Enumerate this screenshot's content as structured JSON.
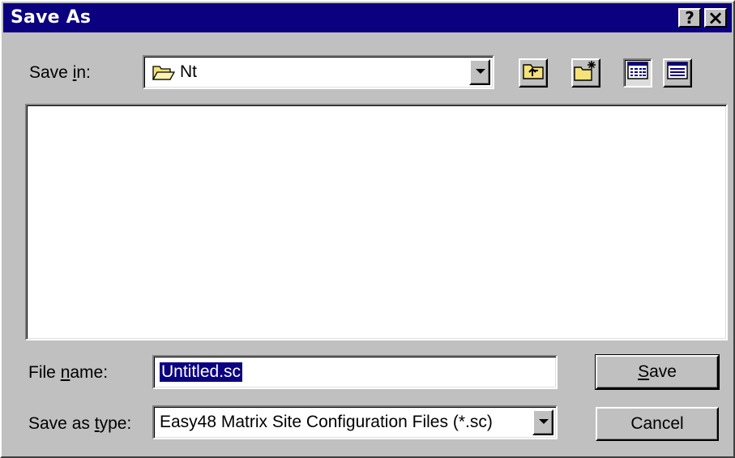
{
  "window": {
    "title": "Save As",
    "help_label": "?",
    "close_label": "×"
  },
  "save_in": {
    "label_pre": "Save ",
    "label_accel": "i",
    "label_post": "n:",
    "value": "Nt",
    "folder_icon": "open-folder-icon"
  },
  "toolbar": {
    "up_icon": "up-one-level-icon",
    "new_folder_icon": "new-folder-icon",
    "list_icon": "list-view-icon",
    "details_icon": "details-view-icon"
  },
  "file_list": {
    "items": []
  },
  "file_name": {
    "label_pre": "File ",
    "label_accel": "n",
    "label_post": "ame:",
    "value": "Untitled.sc"
  },
  "save_type": {
    "label_pre": "Save as ",
    "label_accel": "t",
    "label_post": "ype:",
    "value": "Easy48 Matrix Site Configuration Files (*.sc)"
  },
  "buttons": {
    "save_accel": "S",
    "save_rest": "ave",
    "cancel": "Cancel"
  },
  "colors": {
    "titlebar": "#0a0080",
    "face": "#c0c0c0",
    "selection": "#0a0080"
  }
}
